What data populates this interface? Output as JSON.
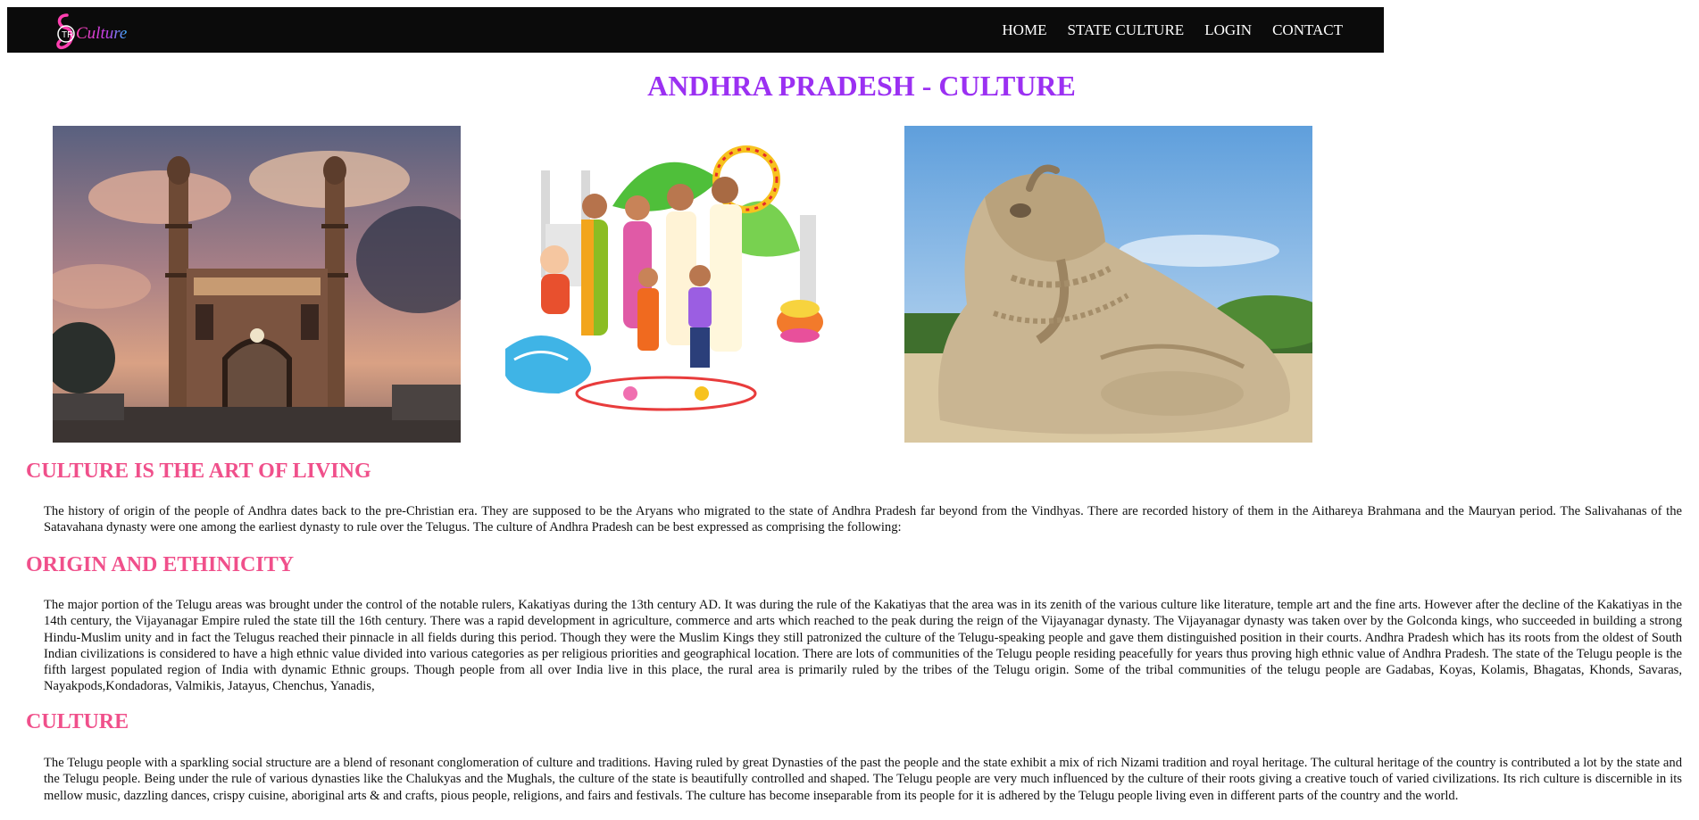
{
  "nav": {
    "logo_text": "Culture",
    "logo_mark": "TR",
    "links": [
      "HOME",
      "STATE CULTURE",
      "LOGIN",
      "CONTACT"
    ]
  },
  "page_title": "ANDHRA PRADESH - CULTURE",
  "images": [
    {
      "icon": "charminar-photo"
    },
    {
      "icon": "telugu-family-illustration"
    },
    {
      "icon": "lepakshi-nandi-photo"
    }
  ],
  "sections": [
    {
      "heading": "CULTURE IS THE ART OF LIVING",
      "text": "The history of origin of the people of Andhra dates back to the pre-Christian era. They are supposed to be the Aryans who migrated to the state of Andhra Pradesh far beyond from the Vindhyas. There are recorded history of them in the Aithareya Brahmana and the Mauryan period. The Salivahanas of the Satavahana dynasty were one among the earliest dynasty to rule over the Telugus. The culture of Andhra Pradesh can be best expressed as comprising the following:"
    },
    {
      "heading": "ORIGIN AND ETHINICITY",
      "text": "The major portion of the Telugu areas was brought under the control of the notable rulers, Kakatiyas during the 13th century AD. It was during the rule of the Kakatiyas that the area was in its zenith of the various culture like literature, temple art and the fine arts. However after the decline of the Kakatiyas in the 14th century, the Vijayanagar Empire ruled the state till the 16th century. There was a rapid development in agriculture, commerce and arts which reached to the peak during the reign of the Vijayanagar dynasty. The Vijayanagar dynasty was taken over by the Golconda kings, who succeeded in building a strong Hindu-Muslim unity and in fact the Telugus reached their pinnacle in all fields during this period. Though they were the Muslim Kings they still patronized the culture of the Telugu-speaking people and gave them distinguished position in their courts. Andhra Pradesh which has its roots from the oldest of South Indian civilizations is considered to have a high ethnic value divided into various categories as per religious priorities and geographical location. There are lots of communities of the Telugu people residing peacefully for years thus proving high ethnic value of Andhra Pradesh. The state of the Telugu people is the fifth largest populated region of India with dynamic Ethnic groups. Though people from all over India live in this place, the rural area is primarily ruled by the tribes of the Telugu origin. Some of the tribal communities of the telugu people are Gadabas, Koyas, Kolamis, Bhagatas, Khonds, Savaras, Nayakpods,Kondadoras, Valmikis, Jatayus, Chenchus, Yanadis,"
    },
    {
      "heading": "CULTURE",
      "text": "The Telugu people with a sparkling social structure are a blend of resonant conglomeration of culture and traditions. Having ruled by great Dynasties of the past the people and the state exhibit a mix of rich Nizami tradition and royal heritage. The cultural heritage of the country is contributed a lot by the state and the Telugu people. Being under the rule of various dynasties like the Chalukyas and the Mughals, the culture of the state is beautifully controlled and shaped. The Telugu people are very much influenced by the culture of their roots giving a creative touch of varied civilizations. Its rich culture is discernible in its mellow music, dazzling dances, crispy cuisine, aboriginal arts & and crafts, pious people, religions, and fairs and festivals. The culture has become inseparable from its people for it is adhered by the Telugu people living even in different parts of the country and the world."
    }
  ]
}
